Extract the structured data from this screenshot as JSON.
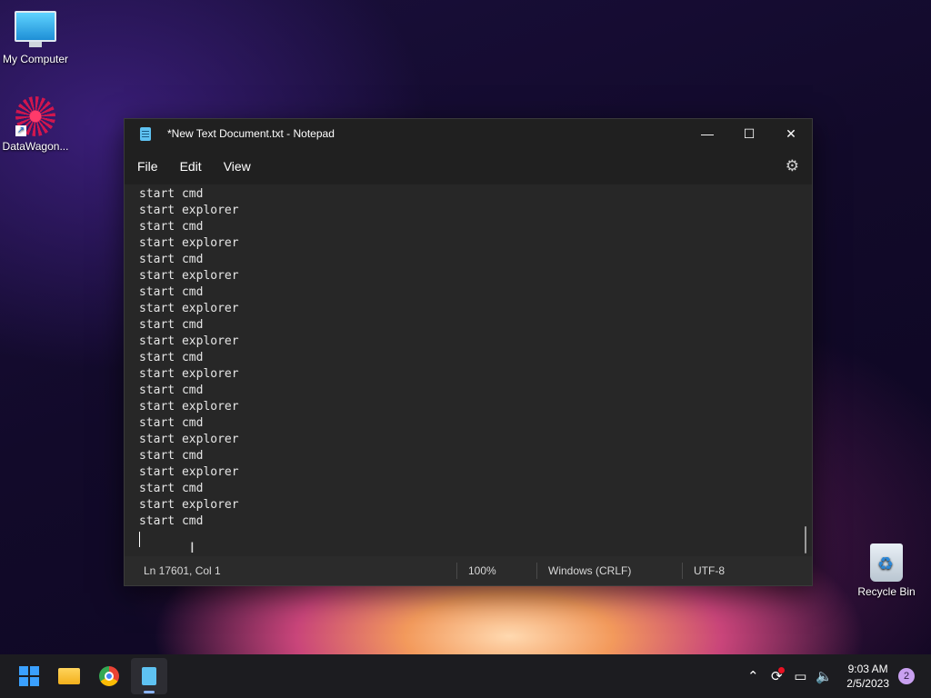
{
  "desktop": {
    "icons": [
      {
        "label": "My Computer",
        "icon": "monitor-icon"
      },
      {
        "label": "DataWagon...",
        "icon": "datawagon-icon"
      },
      {
        "label": "Recycle Bin",
        "icon": "recycle-bin-icon"
      }
    ]
  },
  "window": {
    "title": "*New Text Document.txt - Notepad",
    "controls": {
      "minimize": "—",
      "maximize": "☐",
      "close": "✕"
    },
    "menu": [
      "File",
      "Edit",
      "View"
    ],
    "settings_icon": "⚙"
  },
  "editor": {
    "lines": [
      "start cmd",
      "start explorer",
      "start cmd",
      "start explorer",
      "start cmd",
      "start explorer",
      "start cmd",
      "start explorer",
      "start cmd",
      "start explorer",
      "start cmd",
      "start explorer",
      "start cmd",
      "start explorer",
      "start cmd",
      "start explorer",
      "start cmd",
      "start explorer",
      "start cmd",
      "start explorer",
      "start cmd"
    ]
  },
  "statusbar": {
    "position": "Ln 17601, Col 1",
    "zoom": "100%",
    "line_ending": "Windows (CRLF)",
    "encoding": "UTF-8"
  },
  "taskbar": {
    "clock_time": "9:03 AM",
    "clock_date": "2/5/2023",
    "notification_count": "2"
  }
}
